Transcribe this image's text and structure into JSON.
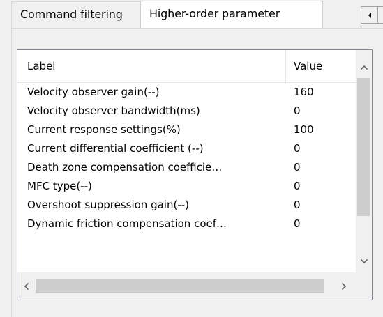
{
  "tabs": [
    {
      "label": "Command filtering",
      "active": false
    },
    {
      "label": "Higher-order parameter",
      "active": true
    }
  ],
  "tab_scroll": {
    "left_icon": "triangle-left-icon",
    "right_icon": "triangle-right-icon"
  },
  "table": {
    "columns": [
      "Label",
      "Value"
    ],
    "rows": [
      {
        "label": "Velocity observer gain(--)",
        "value": "160"
      },
      {
        "label": "Velocity observer bandwidth(ms)",
        "value": "0"
      },
      {
        "label": "Current response settings(%)",
        "value": "100"
      },
      {
        "label": "Current differential coefficient (--)",
        "value": "0"
      },
      {
        "label": "Death zone compensation coefficie…",
        "value": "0"
      },
      {
        "label": "MFC type(--)",
        "value": "0"
      },
      {
        "label": "Overshoot suppression gain(--)",
        "value": "0"
      },
      {
        "label": "Dynamic friction compensation coef…",
        "value": "0"
      }
    ]
  },
  "scrollbars": {
    "up_icon": "chevron-up-icon",
    "down_icon": "chevron-down-icon",
    "left_icon": "chevron-left-icon",
    "right_icon": "chevron-right-icon"
  }
}
